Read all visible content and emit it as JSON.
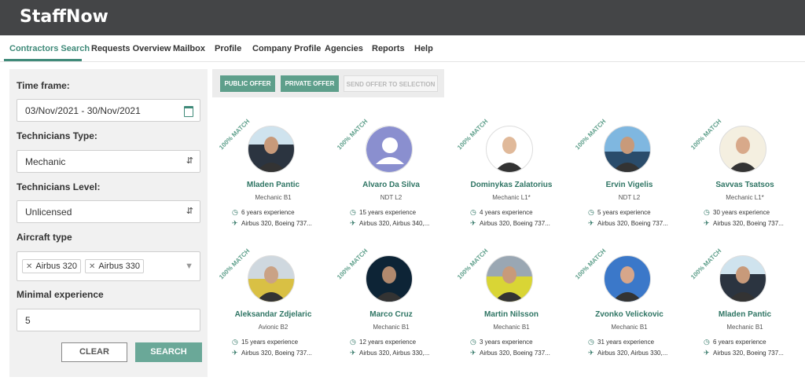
{
  "app": {
    "logo": "StaffNow"
  },
  "nav": {
    "items": [
      "Contractors Search",
      "Requests Overview",
      "Mailbox",
      "Profile",
      "Company Profile",
      "Agencies",
      "Reports",
      "Help"
    ]
  },
  "filters": {
    "time_frame_label": "Time frame:",
    "time_frame_value": "03/Nov/2021 - 30/Nov/2021",
    "tech_type_label": "Technicians Type:",
    "tech_type_value": "Mechanic",
    "tech_level_label": "Technicians Level:",
    "tech_level_value": "Unlicensed",
    "aircraft_label": "Aircraft type",
    "aircraft_tags": [
      "Airbus 320",
      "Airbus 330"
    ],
    "min_exp_label": "Minimal experience",
    "min_exp_value": "5",
    "clear_label": "CLEAR",
    "search_label": "SEARCH"
  },
  "offers": {
    "public": "PUBLIC OFFER",
    "private": "PRIVATE OFFER",
    "send": "SEND OFFER TO SELECTION"
  },
  "match_label": "100% MATCH",
  "contractors": [
    {
      "name": "Mladen Pantic",
      "role": "Mechanic B1",
      "experience": "6 years experience",
      "aircraft": "Airbus 320, Boeing 737...",
      "photo": "person"
    },
    {
      "name": "Alvaro Da Silva",
      "role": "NDT L2",
      "experience": "15 years experience",
      "aircraft": "Airbus 320, Airbus 340,...",
      "photo": "placeholder"
    },
    {
      "name": "Dominykas Zalatorius",
      "role": "Mechanic L1*",
      "experience": "4 years experience",
      "aircraft": "Airbus 320, Boeing 737...",
      "photo": "person"
    },
    {
      "name": "Ervin Vigelis",
      "role": "NDT L2",
      "experience": "5 years experience",
      "aircraft": "Airbus 320, Boeing 737...",
      "photo": "person"
    },
    {
      "name": "Savvas Tsatsos",
      "role": "Mechanic L1*",
      "experience": "30 years experience",
      "aircraft": "Airbus 320, Boeing 737...",
      "photo": "person"
    },
    {
      "name": "Aleksandar Zdjelaric",
      "role": "Avionic B2",
      "experience": "15 years experience",
      "aircraft": "Airbus 320, Boeing 737...",
      "photo": "person"
    },
    {
      "name": "Marco Cruz",
      "role": "Mechanic B1",
      "experience": "12 years experience",
      "aircraft": "Airbus 320, Airbus 330,...",
      "photo": "person"
    },
    {
      "name": "Martin Nilsson",
      "role": "Mechanic B1",
      "experience": "3 years experience",
      "aircraft": "Airbus 320, Boeing 737...",
      "photo": "person"
    },
    {
      "name": "Zvonko Velickovic",
      "role": "Mechanic B1",
      "experience": "31 years experience",
      "aircraft": "Airbus 320, Airbus 330,...",
      "photo": "person"
    },
    {
      "name": "Mladen Pantic",
      "role": "Mechanic B1",
      "experience": "6 years experience",
      "aircraft": "Airbus 320, Boeing 737...",
      "photo": "person"
    }
  ],
  "colors": {
    "accent": "#3f8a79",
    "topbar": "#444547",
    "button": "#6aa898"
  }
}
